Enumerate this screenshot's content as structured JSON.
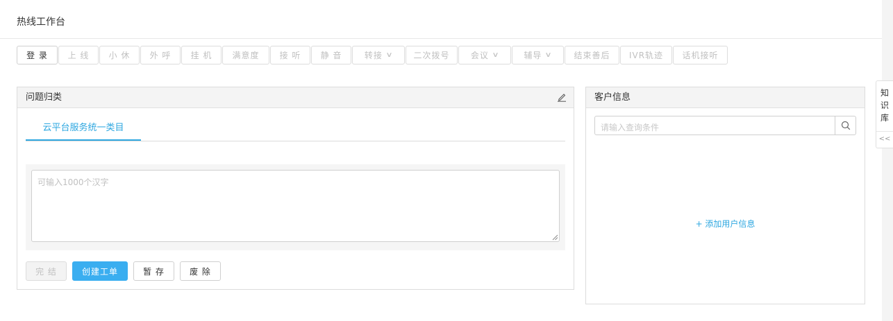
{
  "page": {
    "title": "热线工作台"
  },
  "toolbar": {
    "buttons": [
      {
        "label": "登 录",
        "enabled": true
      },
      {
        "label": "上 线"
      },
      {
        "label": "小 休"
      },
      {
        "label": "外 呼"
      },
      {
        "label": "挂 机"
      },
      {
        "label": "满意度"
      },
      {
        "label": "接 听"
      },
      {
        "label": "静 音"
      },
      {
        "label": "转接",
        "dropdown": true
      },
      {
        "label": "二次拨号"
      },
      {
        "label": "会议",
        "dropdown": true
      },
      {
        "label": "辅导",
        "dropdown": true
      },
      {
        "label": "结束善后"
      },
      {
        "label": "IVR轨迹"
      },
      {
        "label": "话机接听"
      }
    ]
  },
  "issue_panel": {
    "title": "问题归类",
    "tab": "云平台服务统一类目",
    "textarea_placeholder": "可输入1000个汉字",
    "actions": {
      "done": "完 结",
      "create": "创建工单",
      "save": "暂 存",
      "discard": "废 除"
    }
  },
  "customer_panel": {
    "title": "客户信息",
    "search_placeholder": "请输入查询条件",
    "add_user": "+ 添加用户信息"
  },
  "side_tab": {
    "label": "知识库",
    "collapse": "<<"
  },
  "colors": {
    "accent": "#3aaef0",
    "link": "#2ea7e0"
  },
  "icons": {
    "edit": "pencil-icon",
    "search": "search-icon",
    "dropdown": "chevron-down-icon"
  }
}
